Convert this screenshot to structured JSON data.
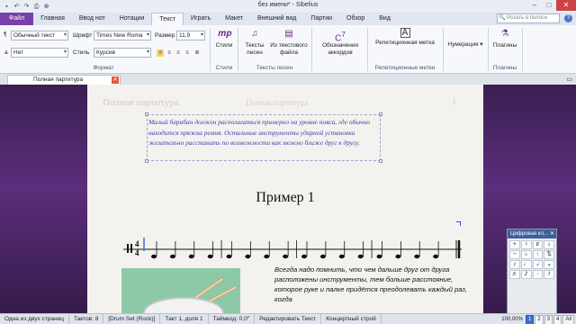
{
  "window": {
    "title": "без имени* - Sibelius"
  },
  "quick_access": [
    "save-icon",
    "undo-icon",
    "redo-icon",
    "print-icon",
    "zoom-icon"
  ],
  "ribbon_tabs": [
    {
      "label": "Файл",
      "kind": "file"
    },
    {
      "label": "Главная"
    },
    {
      "label": "Ввод нот"
    },
    {
      "label": "Нотации"
    },
    {
      "label": "Текст",
      "active": true
    },
    {
      "label": "Играть"
    },
    {
      "label": "Макет"
    },
    {
      "label": "Внешний вид"
    },
    {
      "label": "Партии"
    },
    {
      "label": "Обзор"
    },
    {
      "label": "Вид"
    }
  ],
  "search": {
    "placeholder": "Искать в полосе"
  },
  "format_group": {
    "style_value": "Обычный текст",
    "font_label": "Шрифт",
    "font_value": "Times New Roma",
    "size_label": "Размер",
    "size_value": "11,9",
    "a_label": "а",
    "variant_value": "Нет",
    "style_label": "Стиль",
    "style2_value": "Курсив",
    "group_label": "Формат"
  },
  "styles_group": {
    "button_label": "Стили",
    "group_label": "Стили"
  },
  "lyrics_group": {
    "lyrics_button": "Тексты песен",
    "from_file_button": "Из текстового файла",
    "group_label": "Тексты песен"
  },
  "chords_group": {
    "button_label": "Обозначения аккордов"
  },
  "rehearsal_group": {
    "button_label": "Репетиционная метка",
    "group_label": "Репетиционные метки"
  },
  "numbering_group": {
    "button_label": "Нумерация"
  },
  "plugins_group": {
    "button_label": "Плагины",
    "group_label": "Плагины"
  },
  "document_tab": {
    "label": "Полная партитура"
  },
  "score": {
    "header_left": "Полная партитура",
    "header_center": "Полная партитура",
    "page_number": "1",
    "note_text": "Малый барабан должен располагаться примерно на уровне пояса, где обычно находится пряжка ремня. Остальные инструменты ударной установки желательно расставить по возможности как можно ближе друг к другу.",
    "example_title": "Пример 1",
    "time_sig_top": "4",
    "time_sig_bottom": "4",
    "body_text": "Всегда надо помнить, что чем дальше друг от друга расположены инструменты, тем больше расстояние, которое руке и палке придётся преодолевать каждый раз, когда"
  },
  "keypad": {
    "title": "Цифровая кл...",
    "keys": [
      "+",
      "♮",
      "♯",
      "♭",
      "−",
      "♭",
      "↑",
      "⇅",
      "♪",
      "♩",
      "𝅗𝅥",
      "𝅝",
      "♬",
      "𝅘𝅥𝅯",
      "·",
      "𝄽"
    ]
  },
  "status": {
    "page": "Одна из двух страниц",
    "bars": "Тактов: 8",
    "instrument": "[Drum Set (Rock)]",
    "position": "Такт 1, доля 1",
    "timecode": "Таймкод: 0,0\"",
    "mode": "Редактировать Текст",
    "pitch": "Концертный строй",
    "zoom": "100,00%",
    "view_buttons": [
      "1",
      "2",
      "3",
      "4",
      "All"
    ]
  },
  "colors": {
    "file_tab": "#7a3fa8",
    "canvas_bg": "#4a2568",
    "note_text": "#3a3fb8",
    "paper": "#f4f2ee"
  }
}
